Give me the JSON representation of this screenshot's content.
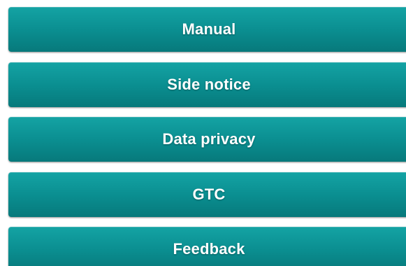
{
  "menu": {
    "items": [
      {
        "label": "Manual"
      },
      {
        "label": "Side notice"
      },
      {
        "label": "Data privacy"
      },
      {
        "label": "GTC"
      },
      {
        "label": "Feedback"
      }
    ]
  },
  "colors": {
    "button_background": "#0a8d8f",
    "button_text": "#ffffff",
    "page_background": "#ffffff"
  }
}
